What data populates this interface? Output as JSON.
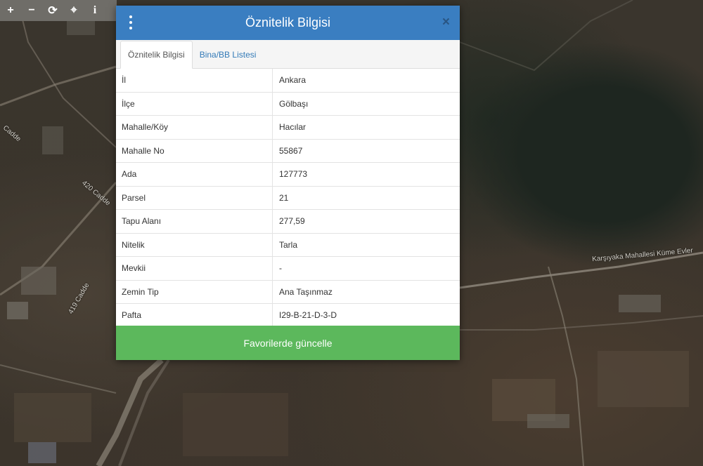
{
  "toolbar": {
    "buttons": [
      {
        "icon": "plus-icon",
        "glyph": "+"
      },
      {
        "icon": "minus-icon",
        "glyph": "−"
      },
      {
        "icon": "refresh-icon",
        "glyph": "⟳"
      },
      {
        "icon": "locate-icon",
        "glyph": "⌖"
      },
      {
        "icon": "info-icon",
        "glyph": "i"
      }
    ]
  },
  "map": {
    "labels": [
      "420 Cadde",
      "419 Cadde",
      "Cadde",
      "Karşıyaka Mahallesi Küme Evler"
    ]
  },
  "modal": {
    "title": "Öznitelik Bilgisi",
    "close_glyph": "×",
    "tabs": [
      "Öznitelik Bilgisi",
      "Bina/BB Listesi"
    ],
    "rows": [
      {
        "key": "İl",
        "value": "Ankara"
      },
      {
        "key": "İlçe",
        "value": "Gölbaşı"
      },
      {
        "key": "Mahalle/Köy",
        "value": "Hacılar"
      },
      {
        "key": "Mahalle No",
        "value": "55867"
      },
      {
        "key": "Ada",
        "value": "127773"
      },
      {
        "key": "Parsel",
        "value": "21"
      },
      {
        "key": "Tapu Alanı",
        "value": "277,59"
      },
      {
        "key": "Nitelik",
        "value": "Tarla"
      },
      {
        "key": "Mevkii",
        "value": "-"
      },
      {
        "key": "Zemin Tip",
        "value": "Ana Taşınmaz"
      },
      {
        "key": "Pafta",
        "value": "I29-B-21-D-3-D"
      }
    ],
    "footer_button": "Favorilerde güncelle"
  },
  "colors": {
    "header": "#3a7ec1",
    "footer": "#5cb85c",
    "link": "#337ab7"
  }
}
